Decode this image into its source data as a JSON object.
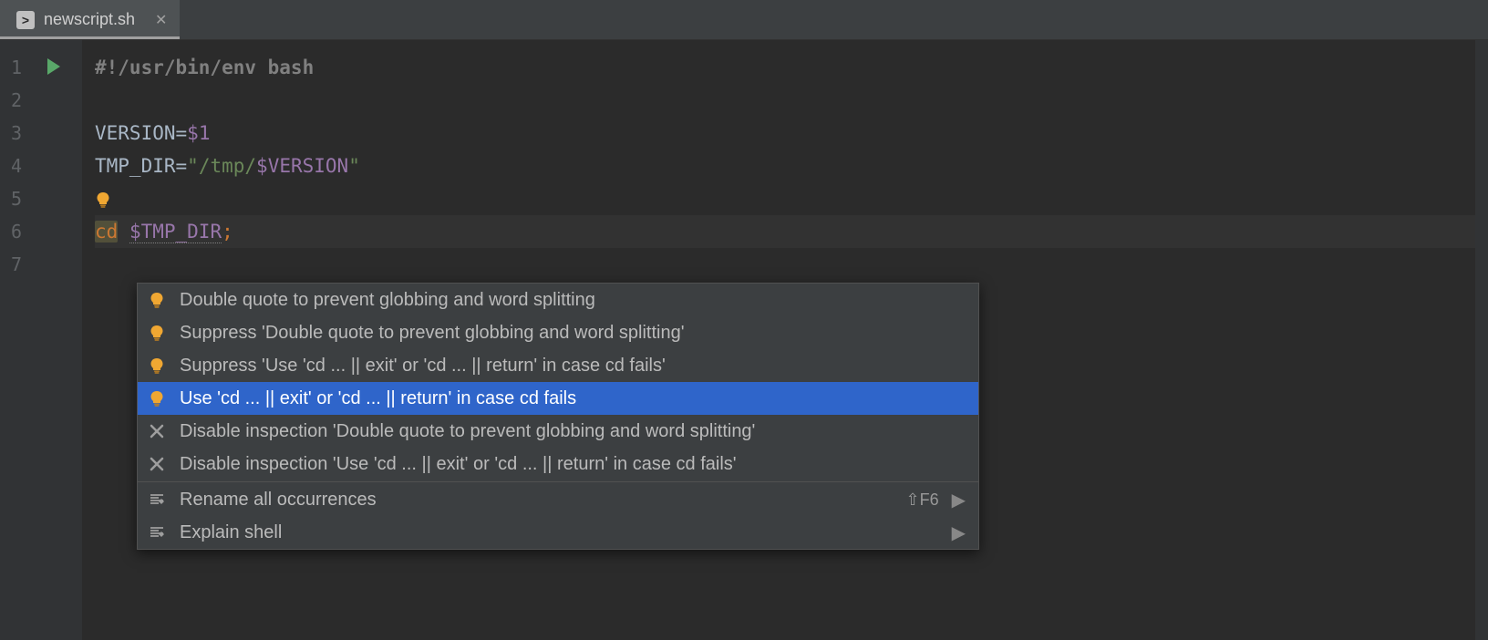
{
  "tab": {
    "filename": "newscript.sh"
  },
  "gutter": {
    "lines": [
      "1",
      "2",
      "3",
      "4",
      "5",
      "6",
      "7"
    ]
  },
  "code": {
    "l1": {
      "shebang": "#!/usr/bin/env bash"
    },
    "l3": {
      "var": "VERSION",
      "eq": "=",
      "param": "$1"
    },
    "l4": {
      "var": "TMP_DIR",
      "eq": "=",
      "q1": "\"",
      "str1": "/tmp/",
      "param": "$VERSION",
      "q2": "\""
    },
    "l6": {
      "cmd": "cd",
      "sp": " ",
      "arg": "$TMP_DIR",
      "semi": ";"
    }
  },
  "popup": {
    "items": [
      {
        "icon": "bulb",
        "label": "Double quote to prevent globbing and word splitting"
      },
      {
        "icon": "bulb",
        "label": "Suppress 'Double quote to prevent globbing and word splitting'"
      },
      {
        "icon": "bulb",
        "label": "Suppress 'Use 'cd ... || exit' or 'cd ... || return' in case cd fails'"
      },
      {
        "icon": "bulb",
        "label": "Use 'cd ... || exit' or 'cd ... || return' in case cd fails",
        "selected": true
      },
      {
        "icon": "x",
        "label": "Disable inspection 'Double quote to prevent globbing and word splitting'"
      },
      {
        "icon": "x",
        "label": "Disable inspection 'Use 'cd ... || exit' or 'cd ... || return' in case cd fails'"
      }
    ],
    "footer": [
      {
        "icon": "rename",
        "label": "Rename all occurrences",
        "shortcut": "⇧F6",
        "sub": true
      },
      {
        "icon": "rename",
        "label": "Explain shell",
        "sub": true
      }
    ]
  }
}
